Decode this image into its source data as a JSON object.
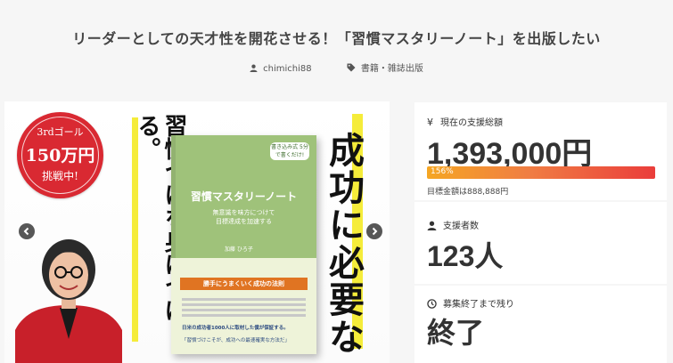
{
  "page": {
    "title": "リーダーとしての天才性を開花させる！「習慣マスタリーノート」を出版したい",
    "author": "chimichi88",
    "category": "書籍・雑誌出版"
  },
  "hero": {
    "badge_line1": "3rdゴール",
    "badge_line2": "150万円",
    "badge_line3": "挑戦中!",
    "vertical_left": "習慣づけを身につける。",
    "vertical_right": "成功に必要な",
    "book": {
      "tag": "書き込み式 5分で書くだけ!",
      "title": "習慣マスタリーノート",
      "subtitle_line1": "無意識を味方につけて",
      "subtitle_line2": "目標達成を加速する",
      "author": "加藤 ひろ子",
      "band": "勝手にうまくいく成功の法則",
      "promo1": "日米の成功者1000人に取材した僕が保証する。",
      "promo2": "「習慣づけこそが、成功への最速確実な方法だ」"
    }
  },
  "stats": {
    "funding_label": "現在の支援総額",
    "funding_amount": "1,393,000円",
    "progress_percent": "156%",
    "progress_value": 156,
    "goal_text": "目標金額は888,888円",
    "supporters_label": "支援者数",
    "supporters_value": "123人",
    "time_label": "募集終了まで残り",
    "time_value": "終了"
  },
  "colors": {
    "progress_start": "#f5a623",
    "progress_end": "#ea3d3b",
    "badge": "#d92932",
    "highlight": "#f5ec3a",
    "book_green": "#9fc27a"
  }
}
